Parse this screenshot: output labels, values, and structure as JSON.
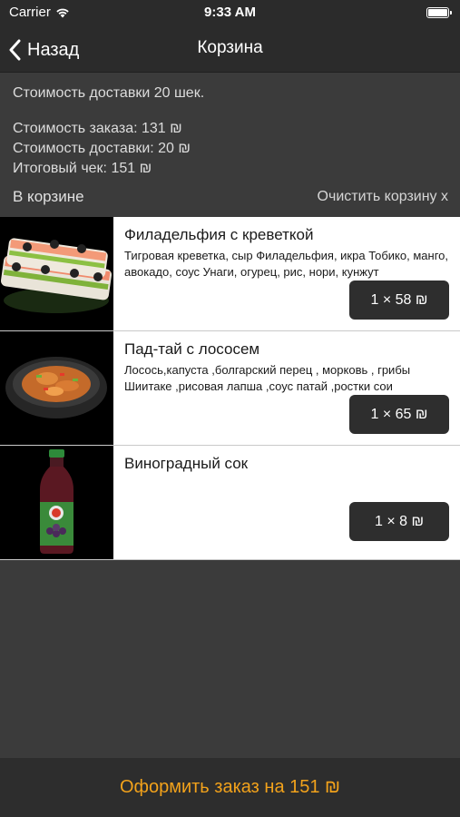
{
  "status": {
    "carrier": "Carrier",
    "time": "9:33 AM"
  },
  "nav": {
    "back_label": "Назад",
    "title": "Корзина"
  },
  "summary": {
    "delivery_note": "Стоимость доставки 20 шек.",
    "order_cost": "Стоимость заказа: 131 ₪",
    "delivery_cost": "Стоимость доставки: 20 ₪",
    "total": "Итоговый чек: 151 ₪"
  },
  "cart": {
    "title": "В корзине",
    "clear_label": "Очистить корзину x"
  },
  "items": [
    {
      "name": "Филадельфия с креветкой",
      "description": "Тигровая  креветка, сыр Филадельфия, икра Тобико, манго, авокадо, соус Унаги, огурец, рис, нори, кунжут",
      "qty_label": "1 × 58 ₪",
      "icon": "sushi-roll-photo"
    },
    {
      "name": "Пад-тай с лососем",
      "description": "Лосось,капуста ,болгарский перец , морковь , грибы Шиитаке ,рисовая лапша ,соус патай ,ростки сои",
      "qty_label": "1 × 65 ₪",
      "icon": "noodle-bowl-photo"
    },
    {
      "name": "Виноградный сок",
      "description": "",
      "qty_label": "1 × 8 ₪",
      "icon": "juice-bottle-photo"
    }
  ],
  "checkout": {
    "label": "Оформить заказ на 151 ₪",
    "color": "#f2a21b"
  }
}
